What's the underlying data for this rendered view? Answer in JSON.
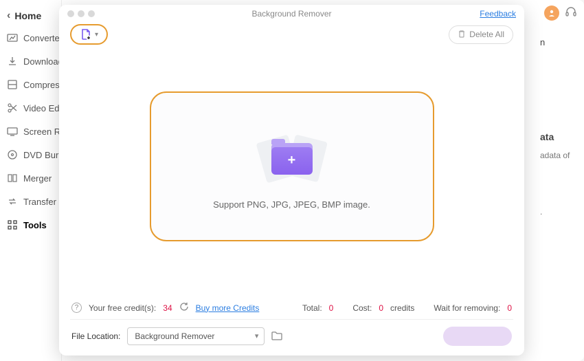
{
  "sidebar": {
    "home": "Home",
    "items": [
      {
        "label": "Converter"
      },
      {
        "label": "Downloader"
      },
      {
        "label": "Compressor"
      },
      {
        "label": "Video Editor"
      },
      {
        "label": "Screen Recorder"
      },
      {
        "label": "DVD Burner"
      },
      {
        "label": "Merger"
      },
      {
        "label": "Transfer"
      },
      {
        "label": "Tools"
      }
    ]
  },
  "bg_panel": {
    "frag1": "n",
    "heading": "ata",
    "frag2": "adata of",
    "frag3": "."
  },
  "modal": {
    "title": "Background Remover",
    "feedback": "Feedback",
    "delete_all": "Delete All",
    "support_text": "Support PNG, JPG, JPEG, BMP image.",
    "credits_label": "Your free credit(s):",
    "credits_value": "34",
    "buy_more": "Buy more Credits",
    "total_label": "Total:",
    "total_value": "0",
    "cost_label": "Cost:",
    "cost_value": "0",
    "cost_unit": "credits",
    "wait_label": "Wait for removing:",
    "wait_value": "0",
    "file_location_label": "File Location:",
    "file_location_value": "Background Remover"
  }
}
